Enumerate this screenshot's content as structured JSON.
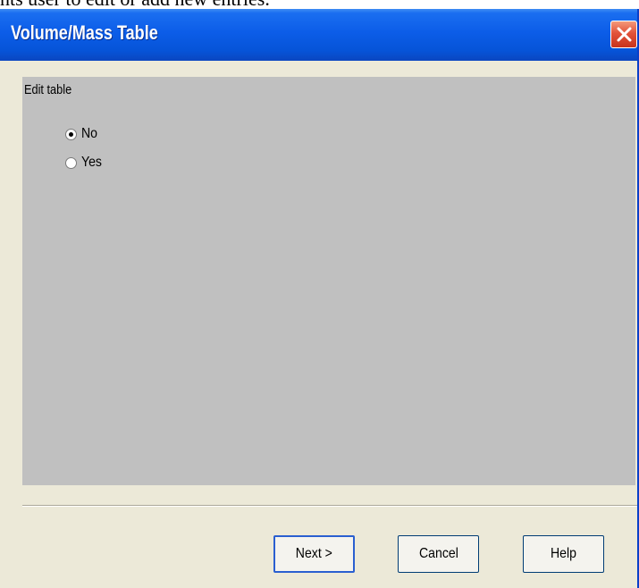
{
  "background_text": "nts user to edit or add new entries.",
  "dialog": {
    "title": "Volume/Mass Table",
    "close_icon": "close-icon"
  },
  "panel": {
    "label": "Edit table",
    "options": [
      {
        "label": "No",
        "selected": true
      },
      {
        "label": "Yes",
        "selected": false
      }
    ]
  },
  "buttons": {
    "next": "Next >",
    "cancel": "Cancel",
    "help": "Help"
  },
  "colors": {
    "titlebar": "#0c5de8",
    "panel": "#c0c0c0",
    "dialog_bg": "#ece9d8",
    "close": "#e2533a"
  }
}
